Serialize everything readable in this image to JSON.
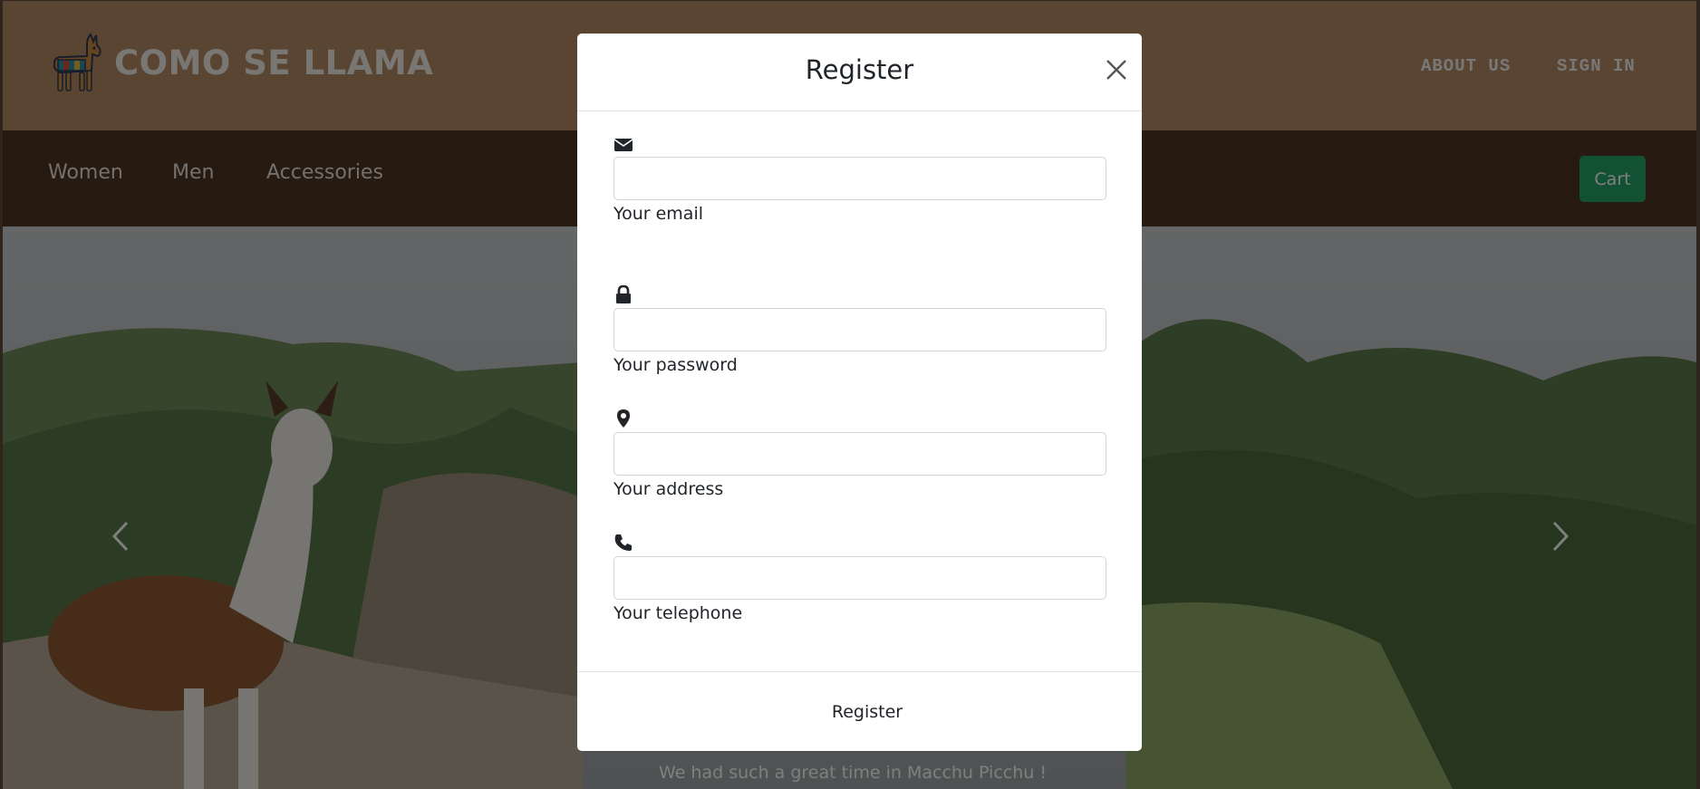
{
  "header": {
    "brand_name": "COMO SE LLAMA",
    "links": [
      "ABOUT US",
      "SIGN IN"
    ]
  },
  "nav": {
    "items": [
      "Women",
      "Men",
      "Accessories"
    ],
    "cart_label": "Cart"
  },
  "hero": {
    "caption": "We had such a great time in Macchu Picchu !"
  },
  "modal": {
    "title": "Register",
    "fields": [
      {
        "icon": "envelope-icon",
        "label": "Your email",
        "value": ""
      },
      {
        "icon": "lock-icon",
        "label": "Your password",
        "value": ""
      },
      {
        "icon": "map-marker-icon",
        "label": "Your address",
        "value": ""
      },
      {
        "icon": "phone-icon",
        "label": "Your telephone",
        "value": ""
      }
    ],
    "submit_label": "Register"
  },
  "colors": {
    "topbar": "#b58a64",
    "navbar": "#4f3421",
    "cart_button": "#25a565",
    "backdrop": "rgba(0,0,0,0.5)"
  }
}
